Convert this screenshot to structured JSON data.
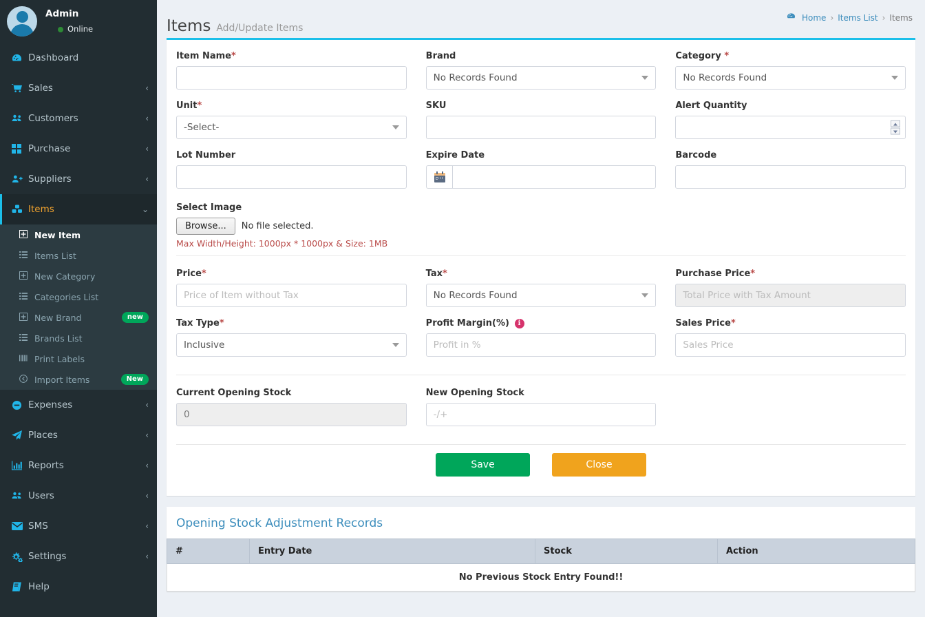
{
  "sidebar": {
    "user": {
      "name": "Admin",
      "status": "Online",
      "avatar_icon": "user-avatar"
    },
    "items": [
      {
        "label": "Dashboard",
        "icon": "dashboard-icon",
        "caret": "",
        "active": false
      },
      {
        "label": "Sales",
        "icon": "cart-icon",
        "caret": "‹",
        "active": false
      },
      {
        "label": "Customers",
        "icon": "users-icon",
        "caret": "‹",
        "active": false
      },
      {
        "label": "Purchase",
        "icon": "grid-icon",
        "caret": "‹",
        "active": false
      },
      {
        "label": "Suppliers",
        "icon": "user-plus-icon",
        "caret": "‹",
        "active": false
      },
      {
        "label": "Items",
        "icon": "cubes-icon",
        "caret": "⌄",
        "active": true
      },
      {
        "label": "Expenses",
        "icon": "minus-circle-icon",
        "caret": "‹",
        "active": false
      },
      {
        "label": "Places",
        "icon": "paper-plane-icon",
        "caret": "‹",
        "active": false
      },
      {
        "label": "Reports",
        "icon": "bar-chart-icon",
        "caret": "‹",
        "active": false
      },
      {
        "label": "Users",
        "icon": "users-icon",
        "caret": "‹",
        "active": false
      },
      {
        "label": "SMS",
        "icon": "envelope-icon",
        "caret": "‹",
        "active": false
      },
      {
        "label": "Settings",
        "icon": "gears-icon",
        "caret": "‹",
        "active": false
      },
      {
        "label": "Help",
        "icon": "book-icon",
        "caret": "",
        "active": false
      }
    ],
    "items_submenu": [
      {
        "label": "New Item",
        "icon": "plus-square-icon",
        "badge": "",
        "active": true
      },
      {
        "label": "Items List",
        "icon": "list-icon",
        "badge": "",
        "active": false
      },
      {
        "label": "New Category",
        "icon": "plus-square-icon",
        "badge": "",
        "active": false
      },
      {
        "label": "Categories List",
        "icon": "list-icon",
        "badge": "",
        "active": false
      },
      {
        "label": "New Brand",
        "icon": "plus-square-icon",
        "badge": "new",
        "active": false
      },
      {
        "label": "Brands List",
        "icon": "list-icon",
        "badge": "",
        "active": false
      },
      {
        "label": "Print Labels",
        "icon": "barcode-icon",
        "badge": "",
        "active": false
      },
      {
        "label": "Import Items",
        "icon": "arrow-circle-left-icon",
        "badge": "New",
        "active": false
      }
    ]
  },
  "header": {
    "title": "Items",
    "subtitle": "Add/Update Items",
    "breadcrumb": [
      {
        "label": "Home",
        "icon": "home-icon",
        "current": false
      },
      {
        "label": "Items List",
        "icon": "",
        "current": false
      },
      {
        "label": "Items",
        "icon": "",
        "current": true
      }
    ],
    "breadcrumb_separator": "›"
  },
  "form": {
    "item_name": {
      "label": "Item Name",
      "required": true,
      "value": "",
      "placeholder": ""
    },
    "brand": {
      "label": "Brand",
      "required": false,
      "value": "No Records Found"
    },
    "category": {
      "label": "Category",
      "required": true,
      "value": "No Records Found"
    },
    "unit": {
      "label": "Unit",
      "required": true,
      "value": "-Select-"
    },
    "sku": {
      "label": "SKU",
      "required": false,
      "value": "",
      "placeholder": ""
    },
    "alert_quantity": {
      "label": "Alert Quantity",
      "required": false,
      "value": "",
      "placeholder": ""
    },
    "lot_number": {
      "label": "Lot Number",
      "required": false,
      "value": "",
      "placeholder": ""
    },
    "expire_date": {
      "label": "Expire Date",
      "required": false,
      "value": "",
      "placeholder": "",
      "addon_icon": "calendar-icon"
    },
    "barcode": {
      "label": "Barcode",
      "required": false,
      "value": "",
      "placeholder": ""
    },
    "select_image": {
      "label": "Select Image",
      "browse_label": "Browse...",
      "file_status": "No file selected.",
      "hint": "Max Width/Height: 1000px * 1000px & Size: 1MB"
    },
    "price": {
      "label": "Price",
      "required": true,
      "value": "",
      "placeholder": "Price of Item without Tax"
    },
    "tax": {
      "label": "Tax",
      "required": true,
      "value": "No Records Found"
    },
    "purchase_price": {
      "label": "Purchase Price",
      "required": true,
      "value": "",
      "placeholder": "Total Price with Tax Amount",
      "disabled": true
    },
    "tax_type": {
      "label": "Tax Type",
      "required": true,
      "value": "Inclusive"
    },
    "profit_margin": {
      "label": "Profit Margin(%)",
      "required": false,
      "value": "",
      "placeholder": "Profit in %",
      "info_icon": "info-icon"
    },
    "sales_price": {
      "label": "Sales Price",
      "required": true,
      "value": "",
      "placeholder": "Sales Price"
    },
    "current_opening_stock": {
      "label": "Current Opening Stock",
      "required": false,
      "value": "0",
      "disabled": true
    },
    "new_opening_stock": {
      "label": "New Opening Stock",
      "required": false,
      "value": "",
      "placeholder": "-/+"
    },
    "save_label": "Save",
    "close_label": "Close"
  },
  "stock_panel": {
    "title": "Opening Stock Adjustment Records",
    "columns": [
      "#",
      "Entry Date",
      "Stock",
      "Action"
    ],
    "empty_message": "No Previous Stock Entry Found!!"
  },
  "colors": {
    "accent_cyan": "#1bbfe9",
    "sidebar_bg": "#222d32",
    "submenu_bg": "#2c3b41",
    "active_orange": "#f0a22e",
    "save_green": "#00a65a",
    "close_orange": "#f0a31d",
    "link_blue": "#3c8dbc",
    "required_red": "#b94a48",
    "info_pink": "#d6336c",
    "badge_green": "#00a65a"
  }
}
